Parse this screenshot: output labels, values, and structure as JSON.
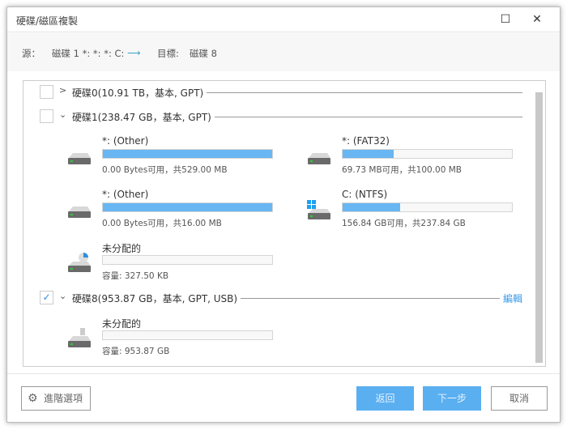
{
  "window": {
    "title": "硬碟/磁區複製",
    "minimize_icon": "minimize-icon",
    "maximize_icon": "maximize-icon",
    "close_icon": "close-icon"
  },
  "header": {
    "source_label": "源：",
    "source_value": "磁碟 1 *: *: *: C:",
    "arrow": "⟶",
    "target_label": "目標:",
    "target_value": "磁碟 8"
  },
  "disks": [
    {
      "label": "硬碟0(10.91 TB，基本, GPT)",
      "checked": false,
      "expanded": false
    },
    {
      "label": "硬碟1(238.47 GB，基本, GPT)",
      "checked": false,
      "expanded": true,
      "partitions": [
        {
          "name": "*: (Other)",
          "info": "0.00 Bytes可用，共529.00 MB",
          "used_percent": 100,
          "icon": "hdd-icon"
        },
        {
          "name": "*: (FAT32)",
          "info": "69.73 MB可用，共100.00 MB",
          "used_percent": 30,
          "icon": "hdd-icon"
        },
        {
          "name": "*: (Other)",
          "info": "0.00 Bytes可用，共16.00 MB",
          "used_percent": 100,
          "icon": "hdd-icon"
        },
        {
          "name": "C: (NTFS)",
          "info": "156.84 GB可用，共237.84 GB",
          "used_percent": 34,
          "icon": "windows-hdd-icon"
        },
        {
          "name": "未分配的",
          "info": "容量: 327.50 KB",
          "used_percent": 0,
          "icon": "unallocated-hdd-icon"
        }
      ]
    },
    {
      "label": "硬碟8(953.87 GB，基本, GPT, USB)",
      "checked": true,
      "expanded": true,
      "edit_label": "編輯",
      "partitions": [
        {
          "name": "未分配的",
          "info": "容量: 953.87 GB",
          "used_percent": 0,
          "icon": "usb-drive-icon"
        }
      ]
    }
  ],
  "footer": {
    "advanced_label": "進階選項",
    "back_label": "返回",
    "next_label": "下一步",
    "cancel_label": "取消"
  },
  "colors": {
    "accent": "#5aaff0",
    "bar_fill": "#68b6f2",
    "link": "#3a9be8"
  }
}
